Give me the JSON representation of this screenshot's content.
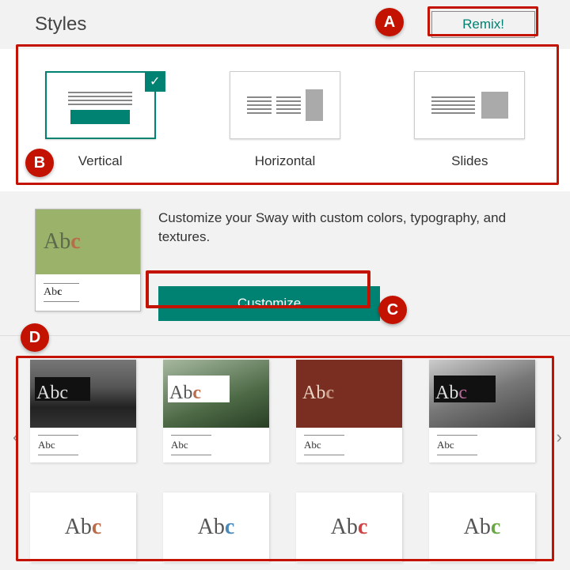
{
  "header": {
    "title": "Styles",
    "remix_label": "Remix!"
  },
  "markers": {
    "a": "A",
    "b": "B",
    "c": "C",
    "d": "D"
  },
  "layouts": {
    "vertical": "Vertical",
    "horizontal": "Horizontal",
    "slides": "Slides",
    "selected": "vertical"
  },
  "customize": {
    "description": "Customize your Sway with custom colors, typography, and textures.",
    "button_label": "Customize",
    "sample_big": "Abc",
    "sample_small": "Abc"
  },
  "gallery": {
    "row1": [
      {
        "abc": "Abc",
        "small": "Abc"
      },
      {
        "abc": "Abc",
        "small": "Abc"
      },
      {
        "abc": "Abc",
        "small": "Abc"
      },
      {
        "abc": "Abc",
        "small": "Abc"
      }
    ],
    "row2": [
      {
        "abc": "Abc"
      },
      {
        "abc": "Abc"
      },
      {
        "abc": "Abc"
      },
      {
        "abc": "Abc"
      }
    ]
  },
  "colors": {
    "accent": "#008272",
    "callout": "#c41200"
  },
  "nav": {
    "left": "‹",
    "right": "›"
  }
}
